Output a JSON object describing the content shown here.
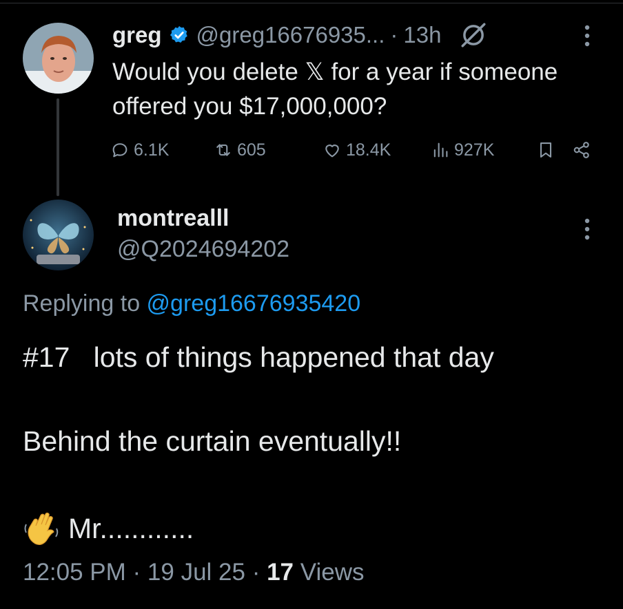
{
  "parent_tweet": {
    "name": "greg",
    "handle": "@greg16676935...",
    "dot": "·",
    "time": "13h",
    "text": "Would you delete 𝕏 for a year if someone offered you $17,000,000?",
    "stats": {
      "replies": "6.1K",
      "reposts": "605",
      "likes": "18.4K",
      "views": "927K"
    },
    "icons": [
      "verified-badge-icon",
      "grok-icon",
      "more-icon",
      "reply-icon",
      "repost-icon",
      "like-icon",
      "views-icon",
      "bookmark-icon",
      "share-icon"
    ]
  },
  "reply_tweet": {
    "name": "montrealll",
    "handle": "@Q2024694202",
    "replying_prefix": "Replying to ",
    "replying_handle": "@greg16676935420",
    "line1": "#17   lots of things happened that day",
    "line2": "Behind the curtain eventually!!",
    "line3": "Mr............",
    "line3_emoji": "waving-hand-icon",
    "meta": {
      "time": "12:05 PM",
      "sep1": " · ",
      "date": "19 Jul 25",
      "sep2": " · ",
      "views_count": "17",
      "views_label": " Views"
    }
  },
  "colors": {
    "background": "#000000",
    "text": "#e7e9ea",
    "secondary": "#8b98a5",
    "accent": "#1d9bf0"
  }
}
